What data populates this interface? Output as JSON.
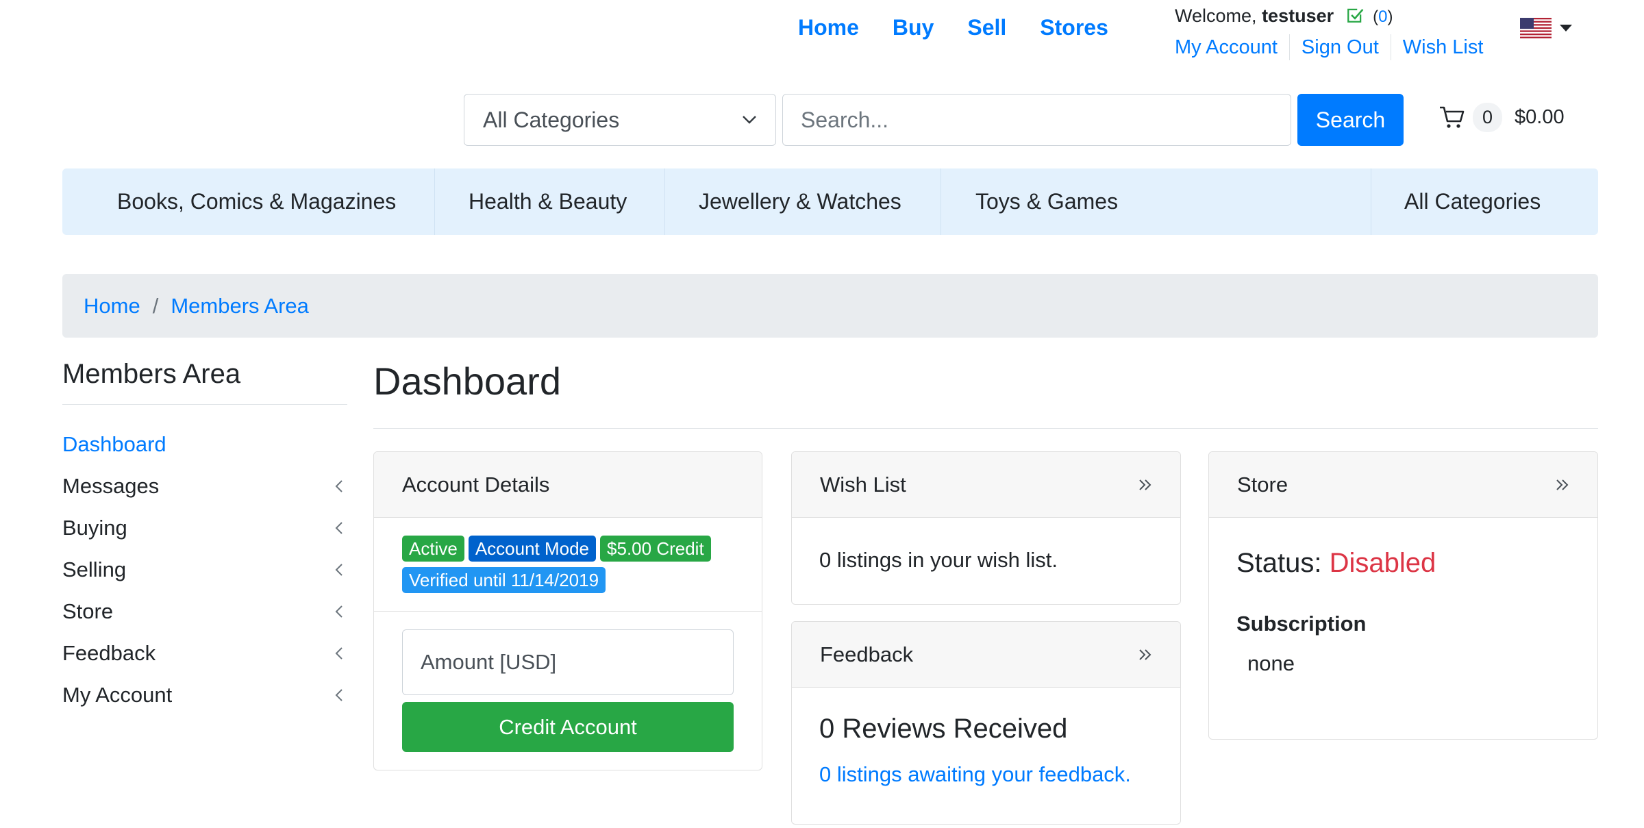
{
  "nav": {
    "home": "Home",
    "buy": "Buy",
    "sell": "Sell",
    "stores": "Stores"
  },
  "user": {
    "welcome": "Welcome,",
    "username": "testuser",
    "message_count": "0",
    "my_account": "My Account",
    "sign_out": "Sign Out",
    "wish_list": "Wish List",
    "locale_icon": "us-flag-icon"
  },
  "search": {
    "category": "All Categories",
    "placeholder": "Search...",
    "button": "Search"
  },
  "cart": {
    "count": "0",
    "total": "$0.00"
  },
  "categories": [
    "Books, Comics & Magazines",
    "Health & Beauty",
    "Jewellery & Watches",
    "Toys & Games",
    "All Categories"
  ],
  "breadcrumb": {
    "home": "Home",
    "separator": "/",
    "current": "Members Area"
  },
  "sidebar": {
    "title": "Members Area",
    "items": [
      {
        "label": "Dashboard"
      },
      {
        "label": "Messages"
      },
      {
        "label": "Buying"
      },
      {
        "label": "Selling"
      },
      {
        "label": "Store"
      },
      {
        "label": "Feedback"
      },
      {
        "label": "My Account"
      }
    ]
  },
  "page": {
    "title": "Dashboard"
  },
  "account_card": {
    "title": "Account Details",
    "badges": {
      "active": "Active",
      "mode": "Account Mode",
      "credit": "$5.00 Credit",
      "verified": "Verified until 11/14/2019"
    },
    "amount_placeholder": "Amount [USD]",
    "credit_button": "Credit Account"
  },
  "wishlist_card": {
    "title": "Wish List",
    "text": "0 listings in your wish list."
  },
  "feedback_card": {
    "title": "Feedback",
    "reviews": "0 Reviews Received",
    "awaiting": "0 listings awaiting your feedback."
  },
  "store_card": {
    "title": "Store",
    "status_label": "Status:",
    "status_value": "Disabled",
    "subscription_label": "Subscription",
    "subscription_value": "none"
  },
  "colors": {
    "primary": "#007bff",
    "success": "#28a745",
    "danger": "#dc3545",
    "info": "#2196f3",
    "mode": "#0062cc",
    "category_bar": "#e3f1fd"
  }
}
